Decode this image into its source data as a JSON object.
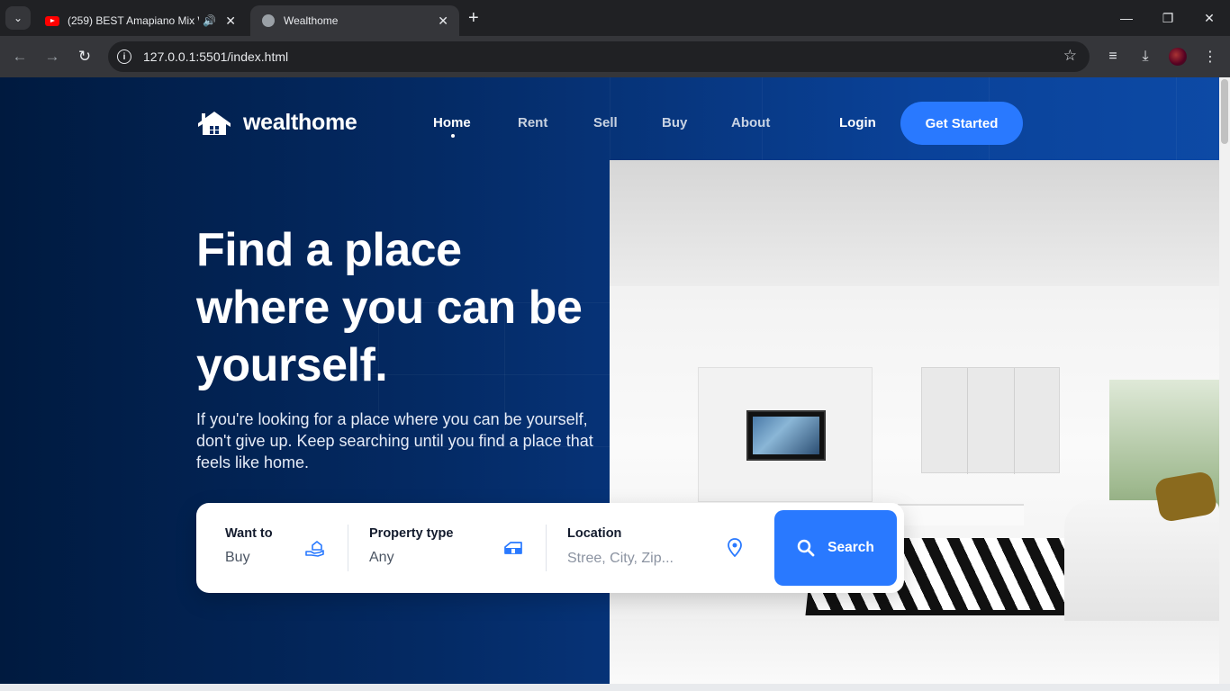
{
  "browser": {
    "tabs": [
      {
        "title": "(259) BEST Amapiano Mix W",
        "icon": "youtube-icon",
        "audio": true
      },
      {
        "title": "Wealthome",
        "icon": "globe-icon",
        "active": true
      }
    ],
    "url": "127.0.0.1:5501/index.html"
  },
  "header": {
    "logo_text": "wealthome",
    "nav": [
      {
        "label": "Home",
        "active": true
      },
      {
        "label": "Rent"
      },
      {
        "label": "Sell"
      },
      {
        "label": "Buy"
      },
      {
        "label": "About"
      }
    ],
    "login_label": "Login",
    "cta_label": "Get Started"
  },
  "hero": {
    "title": "Find a place where you can be yourself.",
    "subtitle": "If you're looking for a place where you can be yourself, don't give up. Keep searching until you find a place that feels like home."
  },
  "search": {
    "want_to": {
      "label": "Want to",
      "value": "Buy",
      "icon": "hand-house-icon"
    },
    "property_type": {
      "label": "Property type",
      "value": "Any",
      "icon": "house-type-icon"
    },
    "location": {
      "label": "Location",
      "placeholder": "Stree, City, Zip...",
      "icon": "location-pin-icon"
    },
    "button_label": "Search"
  },
  "colors": {
    "accent": "#2979ff",
    "hero_dark": "#001a3f",
    "hero_light": "#0d4aa6"
  }
}
